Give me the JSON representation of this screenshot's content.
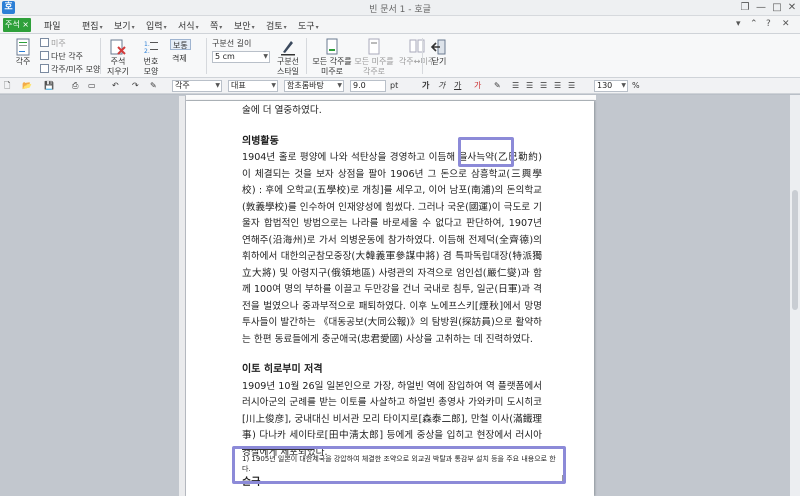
{
  "window": {
    "title": "빈 문서 1 - 호글",
    "app_logo": "호",
    "controls": [
      "❐",
      "—",
      "□",
      "✕"
    ]
  },
  "menu": {
    "active": "주석 ×",
    "items": [
      {
        "label": "파일",
        "arrow": ""
      },
      {
        "label": "편집",
        "arrow": "▾"
      },
      {
        "label": "보기",
        "arrow": "▾"
      },
      {
        "label": "입력",
        "arrow": "▾"
      },
      {
        "label": "서식",
        "arrow": "▾"
      },
      {
        "label": "쪽",
        "arrow": "▾"
      },
      {
        "label": "보안",
        "arrow": "▾"
      },
      {
        "label": "검토",
        "arrow": "▾"
      },
      {
        "label": "도구",
        "arrow": "▾"
      }
    ],
    "right": [
      "▾",
      "⌃",
      "?",
      "✕"
    ]
  },
  "ribbon": {
    "footnote_btn": "각주",
    "footnote_sub": [
      "미주",
      "다단 각주",
      "각주/미주 모양"
    ],
    "delete_note": "주석\n지우기",
    "number_shape": "번호\n모양",
    "normal": "보통",
    "spacing": "격제",
    "separator_length": "구분선 길이",
    "separator_value": "5 cm",
    "separator_style": "구분선\n스타일",
    "all_footnotes": "모든 각주를\n미주로",
    "all_endnotes": "모든 미주를\n각주로",
    "swap": "각주↔미주",
    "close": "닫기"
  },
  "toolbar": {
    "style": "각주",
    "lang": "대표",
    "font": "함초롬바탕",
    "size": "9.0",
    "unit": "pt",
    "zoom": "130",
    "zoom_unit": "%"
  },
  "document": {
    "paragraphs": [
      {
        "type": "text",
        "text": "술에 더 열중하였다."
      },
      {
        "type": "spacer"
      },
      {
        "type": "heading",
        "text": "의병활동"
      },
      {
        "type": "text",
        "text": "1904년 홀로 평양에 나와 석탄상을 경영하고 이듬해 을사늑약(乙巳勒約)이 체결되는 것을 보자 상점을 팔아 1906년 그 돈으로 삼흥학교(三興學校) : 후에 오학교(五學校)로 개칭]를 세우고, 이어 남포(南浦)의 돈의학교(敦義學校)를 인수하여 인재양성에 힘썼다. 그러나 국운(國運)이 극도로 기울자 합법적인 방법으로는 나라를 바로세울 수 없다고 판단하여, 1907년 연해주(沿海州)로 가서 의병운동에 참가하였다. 이듬해 전제덕(全齊德)의 휘하에서 대한의군참모중장(大韓義軍參謀中將) 겸 특파독립대장(特派獨立大將) 및 아령지구(俄領地區) 사령관의 자격으로 엄인섭(嚴仁燮)과 함께 100여 명의 부하를 이끌고 두만강을 건너 국내로 침투, 일군(日軍)과 격전을 벌였으나 중과부적으로 패퇴하였다. 이후 노에프스키[煙秋]에서 망명투사들이 발간하는 《대동공보(大同公報)》의 탐방원(探訪員)으로 활약하는 한편 동료들에게 충군애국(忠君愛國) 사상을 고취하는 데 진력하였다."
      },
      {
        "type": "spacer"
      },
      {
        "type": "heading",
        "text": "이토 히로부미 저격"
      },
      {
        "type": "text",
        "text": "1909년 10월 26일 일본인으로 가장, 하얼빈 역에 잠입하여 역 플랫폼에서 러시아군의 군례를 받는 이토를 사살하고 하얼빈 총영사 가와카미 도시히코[川上俊彦], 궁내대신 비서관 모리 타이지로[森泰二郎], 만철 이사(滿鐵理事) 다나카 세이타로[田中淸太郎] 등에게 중상을 입히고 현장에서 러시아 경찰에게 체포되었다."
      },
      {
        "type": "spacer"
      },
      {
        "type": "heading",
        "text": "순국"
      }
    ],
    "footnote": "1) 1905년 일본이 대한제국을 강압하여 체결한 조약으로 외교권 박탈과 통감부 설치 등을 주요 내용으로 한다."
  }
}
